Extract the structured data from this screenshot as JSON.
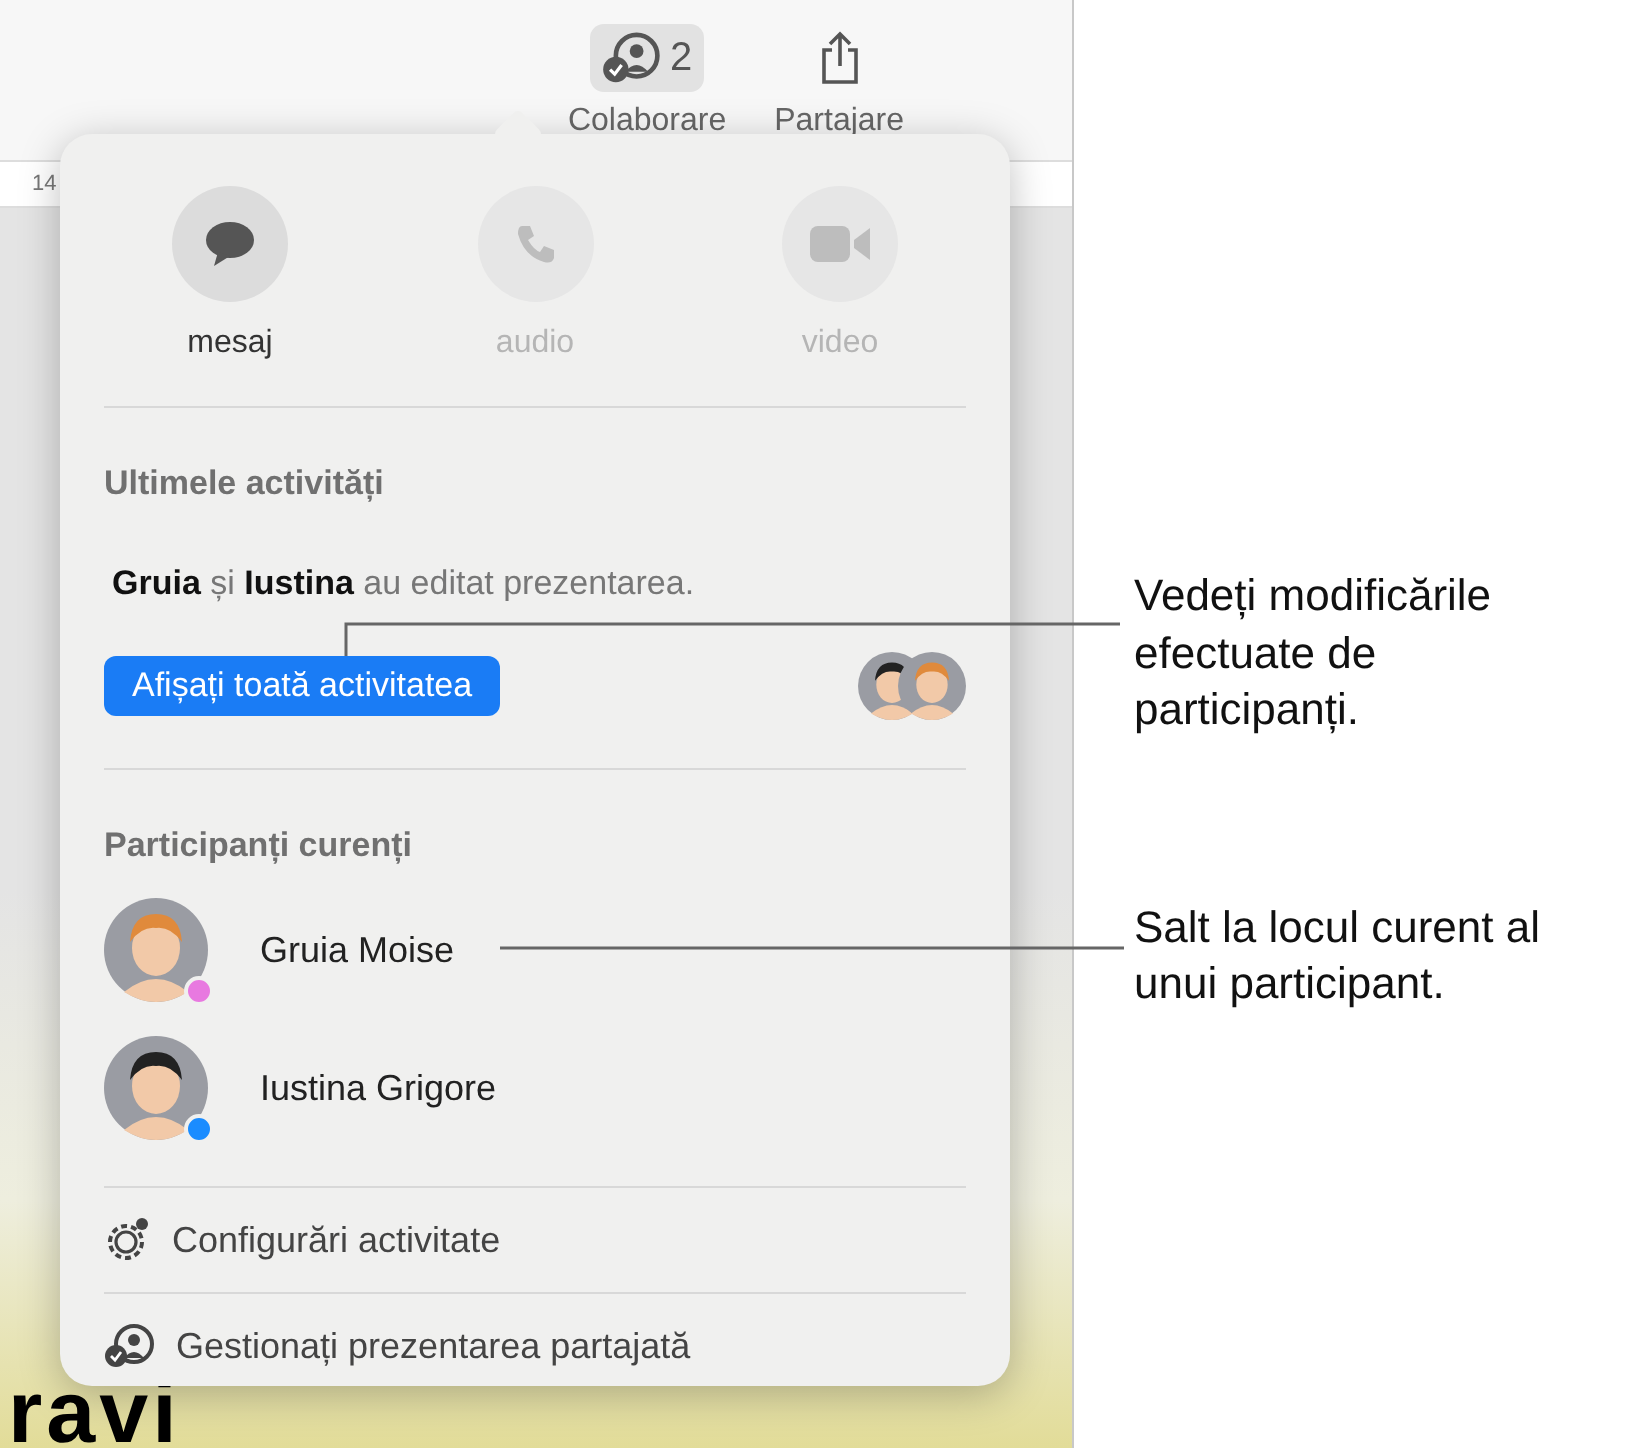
{
  "toolbar": {
    "items": [
      {
        "kind": "collaborate",
        "label": "Colaborare",
        "count": "2",
        "selected": true
      },
      {
        "kind": "share",
        "label": "Partajare",
        "selected": false
      }
    ]
  },
  "ruler": {
    "mark": "14"
  },
  "slide": {
    "text": "ravi"
  },
  "popover": {
    "calls": [
      {
        "kind": "message",
        "label": "mesaj",
        "disabled": false
      },
      {
        "kind": "audio",
        "label": "audio",
        "disabled": true
      },
      {
        "kind": "video",
        "label": "video",
        "disabled": true
      }
    ],
    "recent": {
      "heading": "Ultimele activități",
      "summary": "**Gruia** și **Iustina** au editat prezentarea.",
      "button": "Afișați toată activitatea"
    },
    "participants": {
      "heading": "Participanți curenți",
      "items": [
        {
          "name": "Gruia Moise",
          "color": "#e879e0"
        },
        {
          "name": "Iustina Grigore",
          "color": "#1a8cff"
        }
      ]
    },
    "actions": [
      {
        "kind": "settings",
        "label": "Configurări activitate"
      },
      {
        "kind": "manage",
        "label": "Gestionați prezentarea partajată"
      }
    ]
  },
  "callouts": [
    {
      "text": "Vedeți modificările efectuate de participanți."
    },
    {
      "text": "Salt la locul curent al unui participant."
    }
  ]
}
